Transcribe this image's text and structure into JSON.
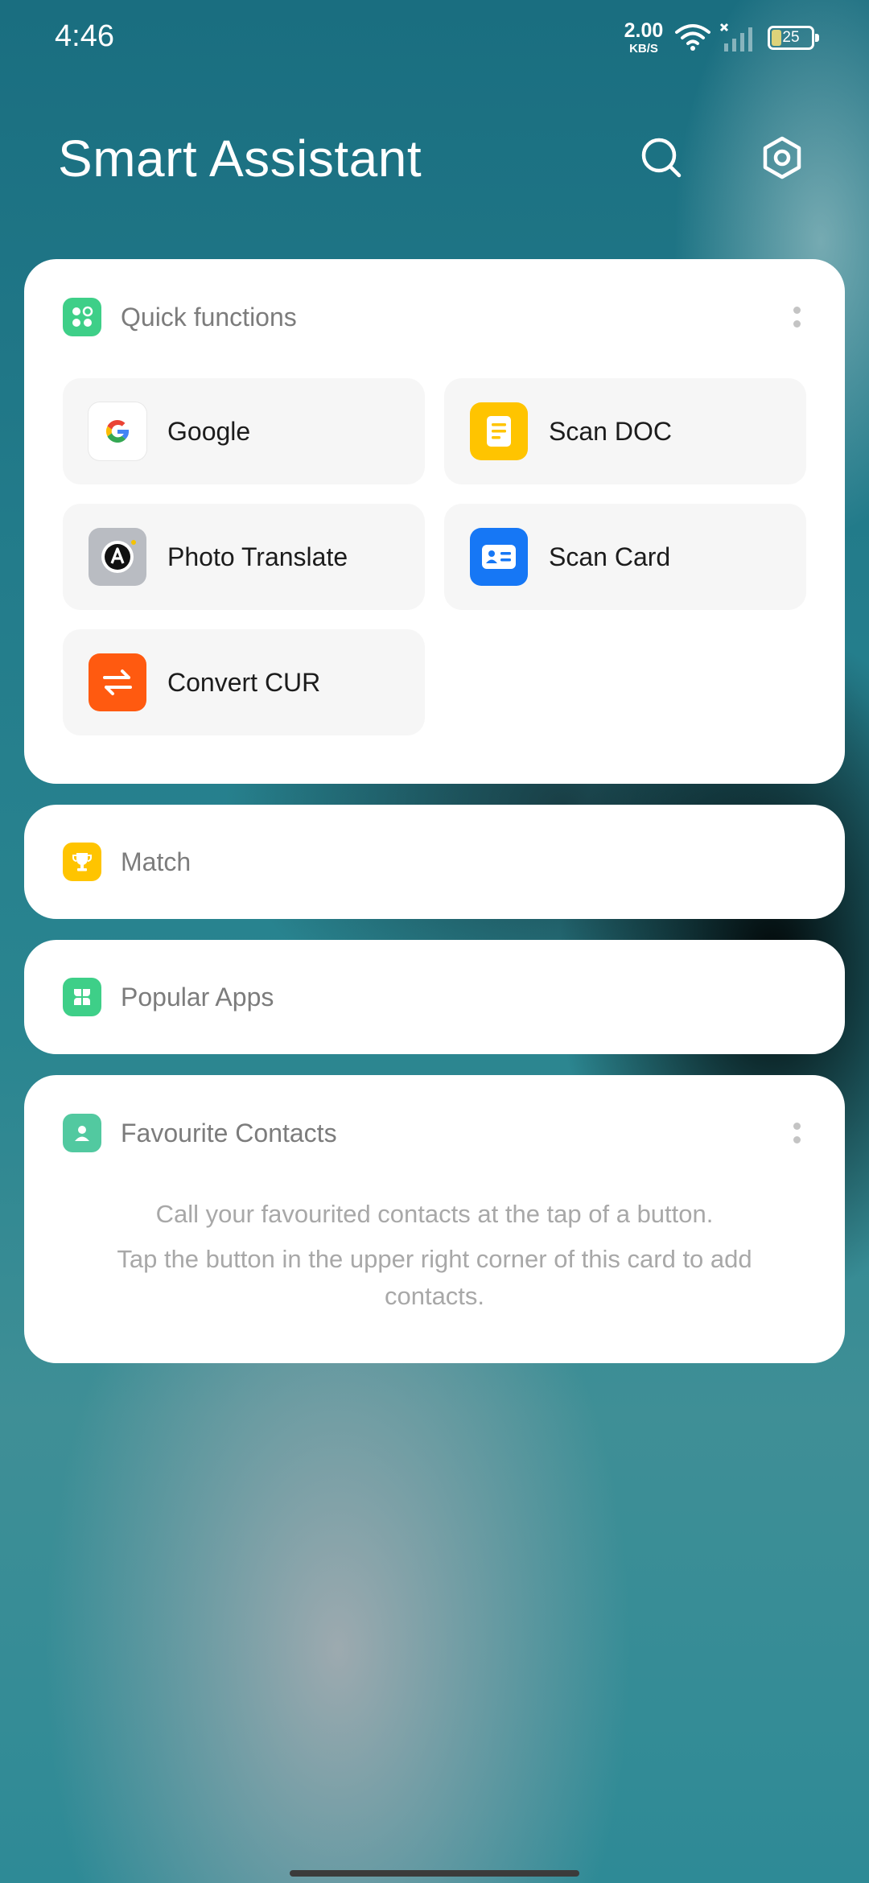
{
  "status_bar": {
    "time": "4:46",
    "net_speed_value": "2.00",
    "net_speed_unit": "KB/S",
    "battery_level": "25"
  },
  "header": {
    "title": "Smart Assistant",
    "icons": [
      "search-icon",
      "settings-icon"
    ]
  },
  "quick_functions": {
    "title": "Quick functions",
    "tiles": [
      {
        "label": "Google",
        "icon": "google-icon"
      },
      {
        "label": "Scan DOC",
        "icon": "scan-doc-icon",
        "color": "#ffc400"
      },
      {
        "label": "Photo Translate",
        "icon": "photo-translate-icon",
        "color": "#b9bcc2"
      },
      {
        "label": "Scan Card",
        "icon": "scan-card-icon",
        "color": "#1677f5"
      },
      {
        "label": "Convert CUR",
        "icon": "convert-currency-icon",
        "color": "#ff5a10"
      }
    ]
  },
  "match": {
    "title": "Match",
    "icon": "trophy-icon",
    "color": "#ffc400"
  },
  "popular_apps": {
    "title": "Popular Apps",
    "icon": "apps-icon",
    "color": "#3ecf88"
  },
  "favourite_contacts": {
    "title": "Favourite Contacts",
    "icon": "contact-icon",
    "color": "#52c9a0",
    "line1": "Call your favourited contacts at the tap of a button.",
    "line2": "Tap the button in the upper right corner of this card to add contacts."
  },
  "colors": {
    "accent_green": "#3ecf88",
    "card_background": "#ffffff",
    "tile_background": "#f6f6f6"
  }
}
